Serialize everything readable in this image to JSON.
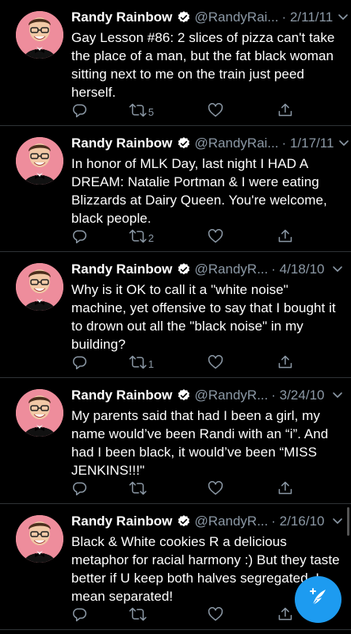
{
  "tweets": [
    {
      "name": "Randy Rainbow",
      "handle": "@RandyRai...",
      "date": "· 2/11/11",
      "text": "Gay Lesson #86: 2 slices of pizza can't take the place of a man, but the fat black woman sitting next to me on the train just peed herself.",
      "retweets": "5",
      "likes": ""
    },
    {
      "name": "Randy Rainbow",
      "handle": "@RandyRai...",
      "date": "· 1/17/11",
      "text": "In honor of MLK Day, last night I HAD A DREAM: Natalie Portman & I were eating Blizzards at Dairy Queen. You're welcome, black people.",
      "retweets": "2",
      "likes": ""
    },
    {
      "name": "Randy Rainbow",
      "handle": "@RandyR...",
      "date": "· 4/18/10",
      "text": "Why is it OK to call it a \"white noise\" machine, yet offensive to say that I bought it to drown out all the \"black noise\" in my building?",
      "retweets": "1",
      "likes": ""
    },
    {
      "name": "Randy Rainbow",
      "handle": "@RandyR...",
      "date": "· 3/24/10",
      "text": "My parents said that had I been a girl, my name would’ve been Randi with an “i”. And had I been black, it would’ve been “MISS JENKINS!!!\"",
      "retweets": "",
      "likes": ""
    },
    {
      "name": "Randy Rainbow",
      "handle": "@RandyR...",
      "date": "· 2/16/10",
      "text": "Black & White cookies R a delicious metaphor for racial harmony :) But they taste better if U keep both halves segregated. I mean separated!",
      "retweets": "",
      "likes": ""
    }
  ],
  "icons": {
    "verified": "verified-badge-icon",
    "chevron": "chevron-down-icon",
    "reply": "reply-icon",
    "retweet": "retweet-icon",
    "like": "heart-icon",
    "share": "share-icon",
    "compose": "compose-tweet-icon"
  },
  "colors": {
    "background": "#000000",
    "secondary_text": "#8b98a5",
    "accent": "#1d9bf0",
    "avatar_bg": "#ee8d9c"
  }
}
